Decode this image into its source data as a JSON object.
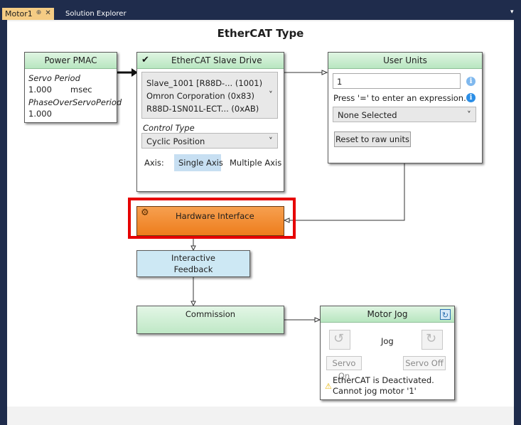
{
  "tabs": {
    "active_label": "Motor1",
    "pin_glyph": "⊕",
    "close_glyph": "✕",
    "inactive_label": "Solution Explorer",
    "overflow_glyph": "▾"
  },
  "page": {
    "title": "EtherCAT Type"
  },
  "power_pmac": {
    "title": "Power PMAC",
    "servo_period_label": "Servo Period",
    "servo_period_value": "1.000",
    "servo_period_unit": "msec",
    "phase_label": "PhaseOverServoPeriod",
    "phase_value": "1.000"
  },
  "slave_drive": {
    "check_glyph": "✔",
    "title": "EtherCAT Slave Drive",
    "device_lines": [
      "Slave_1001 [R88D-... (1001)",
      "Omron Corporation  (0x83)",
      "R88D-1SN01L-ECT... (0xAB)"
    ],
    "control_type_label": "Control Type",
    "control_type_value": "Cyclic Position",
    "axis_label": "Axis:",
    "single_axis": "Single Axis",
    "multiple_axis": "Multiple Axis"
  },
  "user_units": {
    "title": "User Units",
    "value": "1",
    "hint": "Press '=' to enter an expression.",
    "selection": "None Selected",
    "reset_button": "Reset to raw units"
  },
  "hardware_interface": {
    "title": "Hardware Interface",
    "gear_glyph": "⚙"
  },
  "interactive_feedback": {
    "line1": "Interactive",
    "line2": "Feedback"
  },
  "commission": {
    "title": "Commission"
  },
  "motor_jog": {
    "title": "Motor Jog",
    "refresh_glyph": "↻",
    "jog_label": "Jog",
    "ccw_glyph": "↺",
    "cw_glyph": "↻",
    "servo_on": "Servo On",
    "servo_off": "Servo Off",
    "warning_glyph": "⚠",
    "warning_line1": "EtherCAT is Deactivated.",
    "warning_line2": "Cannot jog motor '1'"
  },
  "colors": {
    "highlight": "#e60000",
    "hardware_block": "#f08024",
    "feedback_block": "#cde8f4",
    "green_block": "#c6eacb",
    "tab_active": "#f5cc84",
    "info_icon": "#2b8ee6"
  },
  "chevron": "˅"
}
